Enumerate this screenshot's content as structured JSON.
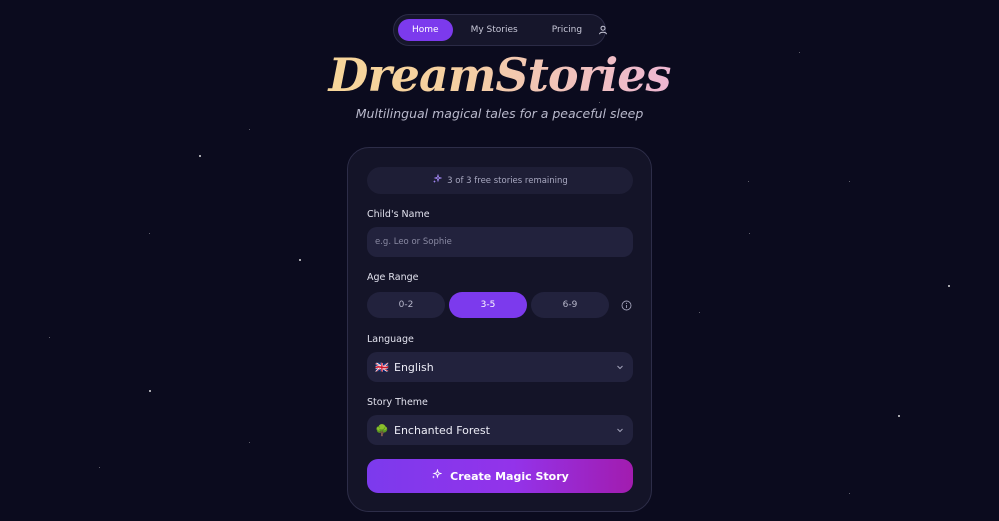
{
  "nav": {
    "home": "Home",
    "stories": "My Stories",
    "pricing": "Pricing",
    "user_icon": "user-icon"
  },
  "hero": {
    "title": "DreamStories",
    "subtitle": "Multilingual magical tales for a peaceful sleep"
  },
  "form": {
    "free_stories": "3 of 3 free stories remaining",
    "sparkle_icon": "sparkles-icon",
    "child_name_label": "Child's Name",
    "child_name_placeholder": "e.g. Leo or Sophie",
    "child_name_value": "",
    "age_label": "Age Range",
    "age_options": [
      "0-2",
      "3-5",
      "6-9"
    ],
    "age_selected": "3-5",
    "info_icon": "info-icon",
    "language_label": "Language",
    "language_flag": "🇬🇧",
    "language_value": "English",
    "theme_label": "Story Theme",
    "theme_emoji": "🌳",
    "theme_value": "Enchanted Forest",
    "create_label": "Create Magic Story"
  },
  "colors": {
    "background": "#0b0b1e",
    "accent": "#7c3aed",
    "card": "#141428",
    "field": "#22223d"
  }
}
